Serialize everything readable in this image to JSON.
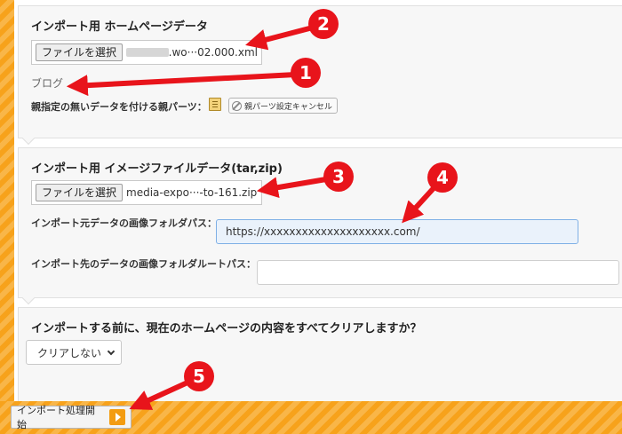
{
  "section1": {
    "title": "インポート用 ホームページデータ",
    "file_button": "ファイルを選択",
    "file_name": ".wo···02.000.xml",
    "blog_label": "ブログ",
    "parent_label": "親指定の無いデータを付ける親パーツ：",
    "cancel_button": "親パーツ設定キャンセル"
  },
  "section2": {
    "title": "インポート用 イメージファイルデータ(tar,zip)",
    "file_button": "ファイルを選択",
    "file_name": "media-expo···-to-161.zip",
    "source_label": "インポート元データの画像フォルダパス：",
    "source_value": "https://xxxxxxxxxxxxxxxxxxxx.com/",
    "dest_label": "インポート先のデータの画像フォルダルートパス：",
    "dest_value": ""
  },
  "section3": {
    "question": "インポートする前に、現在のホームページの内容をすべてクリアしますか？",
    "select_value": "クリアしない"
  },
  "footer": {
    "start_button": "インポート処理開始"
  },
  "annotations": [
    "1",
    "2",
    "3",
    "4",
    "5"
  ],
  "colors": {
    "arrow_red": "#e8141b",
    "accent_orange": "#f7a21b",
    "focus_blue": "#7fb0e6"
  }
}
